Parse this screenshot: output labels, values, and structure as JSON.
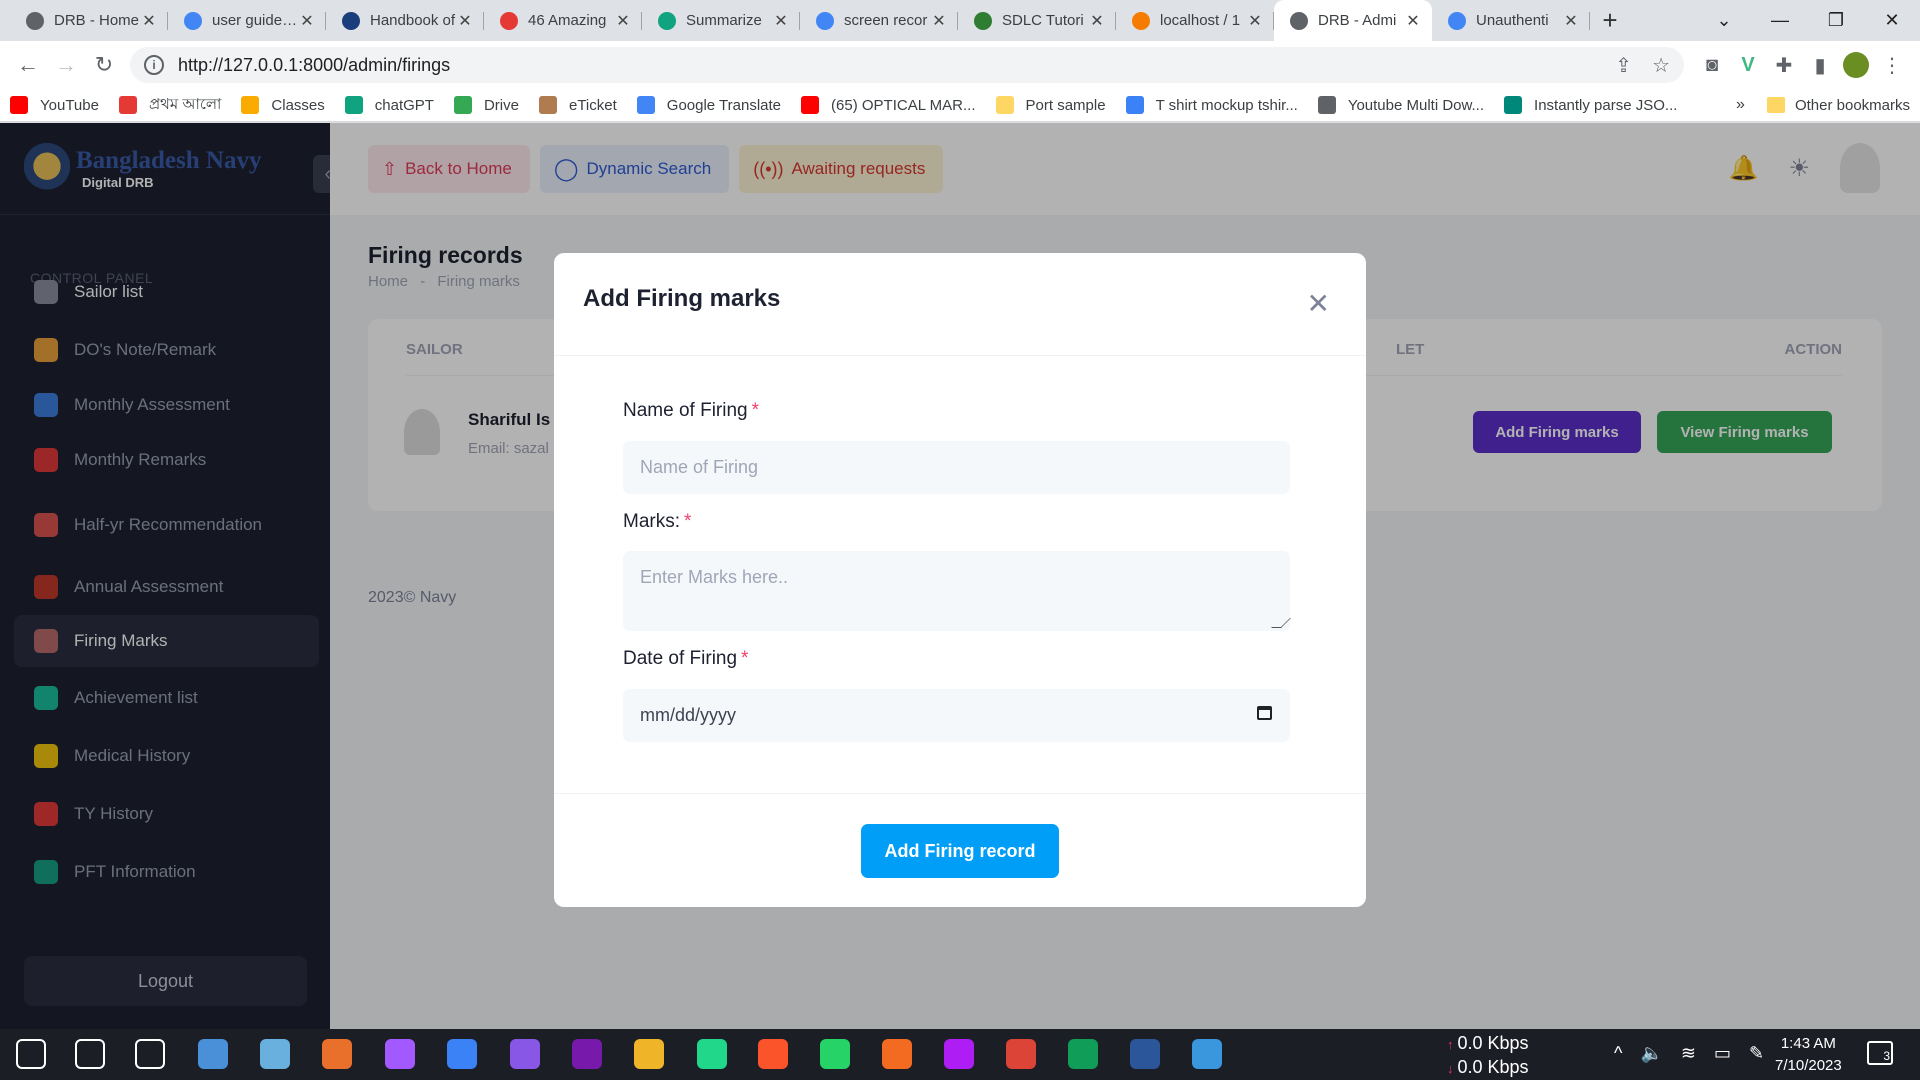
{
  "browser": {
    "tabs": [
      {
        "title": "DRB - Home",
        "color": "#5f6368"
      },
      {
        "title": "user guide ex",
        "color": "#4285f4"
      },
      {
        "title": "Handbook of",
        "color": "#1a3d7c"
      },
      {
        "title": "46 Amazing",
        "color": "#e53935"
      },
      {
        "title": "Summarize",
        "color": "#10a37f"
      },
      {
        "title": "screen recor",
        "color": "#4285f4"
      },
      {
        "title": "SDLC Tutori",
        "color": "#2e7d32"
      },
      {
        "title": "localhost / 1",
        "color": "#f57c00"
      },
      {
        "title": "DRB - Admi",
        "color": "#5f6368"
      },
      {
        "title": "Unauthenti",
        "color": "#4285f4"
      }
    ],
    "url": "http://127.0.0.1:8000/admin/firings",
    "bookmarks": [
      {
        "label": "YouTube",
        "color": "#ff0000"
      },
      {
        "label": "প্রথম আলো",
        "color": "#e53935"
      },
      {
        "label": "Classes",
        "color": "#f9ab00"
      },
      {
        "label": "chatGPT",
        "color": "#10a37f"
      },
      {
        "label": "Drive",
        "color": "#34a853"
      },
      {
        "label": "eTicket",
        "color": "#b07c4f"
      },
      {
        "label": "Google Translate",
        "color": "#4285f4"
      },
      {
        "label": "(65) OPTICAL MAR...",
        "color": "#ff0000"
      },
      {
        "label": "Port sample",
        "color": "#fdd663"
      },
      {
        "label": "T shirt mockup tshir...",
        "color": "#3b82f6"
      },
      {
        "label": "Youtube Multi Dow...",
        "color": "#5f6368"
      },
      {
        "label": "Instantly parse JSO...",
        "color": "#00897b"
      }
    ],
    "bookmarks_more": "»",
    "other_bookmarks": "Other bookmarks"
  },
  "sidebar": {
    "brand_name": "Bangladesh Navy",
    "brand_sub": "Digital DRB",
    "section": "CONTROL PANEL",
    "items": [
      {
        "label": "Sailor list",
        "color": "#8a8f9e"
      },
      {
        "label": "DO's Note/Remark",
        "color": "#e8a13a"
      },
      {
        "label": "Monthly Assessment",
        "color": "#3b7ddd"
      },
      {
        "label": "Monthly Remarks",
        "color": "#e0383b"
      },
      {
        "label": "Half-yr Recommendation",
        "color": "#d9534f"
      },
      {
        "label": "Annual Assessment",
        "color": "#c0392b"
      },
      {
        "label": "Firing Marks",
        "color": "#b86a6a"
      },
      {
        "label": "Achievement list",
        "color": "#1abc9c"
      },
      {
        "label": "Medical History",
        "color": "#f1c40f"
      },
      {
        "label": "TY History",
        "color": "#e23a3a"
      },
      {
        "label": "PFT Information",
        "color": "#16a085"
      }
    ],
    "logout": "Logout"
  },
  "topbar": {
    "back": "Back to Home",
    "search": "Dynamic Search",
    "awaiting": "Awaiting requests"
  },
  "page": {
    "title": "Firing records",
    "breadcrumb_home": "Home",
    "breadcrumb_sep": "-",
    "breadcrumb_current": "Firing marks",
    "col_sailor": "SAILOR",
    "col_let": "LET",
    "col_action": "ACTION",
    "row_name": "Shariful Is",
    "row_email": "Email: sazal",
    "btn_add": "Add Firing marks",
    "btn_view": "View Firing marks",
    "footer": "2023© Navy"
  },
  "modal": {
    "title": "Add Firing marks",
    "name_label": "Name of Firing",
    "name_placeholder": "Name of Firing",
    "marks_label": "Marks:",
    "marks_placeholder": "Enter Marks here..",
    "date_label": "Date of Firing",
    "date_value": "mm/dd/yyyy",
    "required_mark": "*",
    "submit": "Add Firing record"
  },
  "taskbar": {
    "apps": [
      {
        "color": "#ffffff"
      },
      {
        "color": "#ffffff"
      },
      {
        "color": "#ffffff"
      },
      {
        "color": "#4a90d9"
      },
      {
        "color": "#6ab0de"
      },
      {
        "color": "#e8702a"
      },
      {
        "color": "#a259ff"
      },
      {
        "color": "#3b82f6"
      },
      {
        "color": "#8957e5"
      },
      {
        "color": "#7719aa"
      },
      {
        "color": "#f0b429"
      },
      {
        "color": "#21d789"
      },
      {
        "color": "#fb542b"
      },
      {
        "color": "#25d366"
      },
      {
        "color": "#f26b21"
      },
      {
        "color": "#af1df5"
      },
      {
        "color": "#db4437"
      },
      {
        "color": "#0f9d58"
      },
      {
        "color": "#2b579a"
      },
      {
        "color": "#3a96dd"
      }
    ],
    "net_up": "0.0 Kbps",
    "net_down": "0.0 Kbps",
    "time": "1:43 AM",
    "date": "7/10/2023",
    "notifications": "3"
  }
}
